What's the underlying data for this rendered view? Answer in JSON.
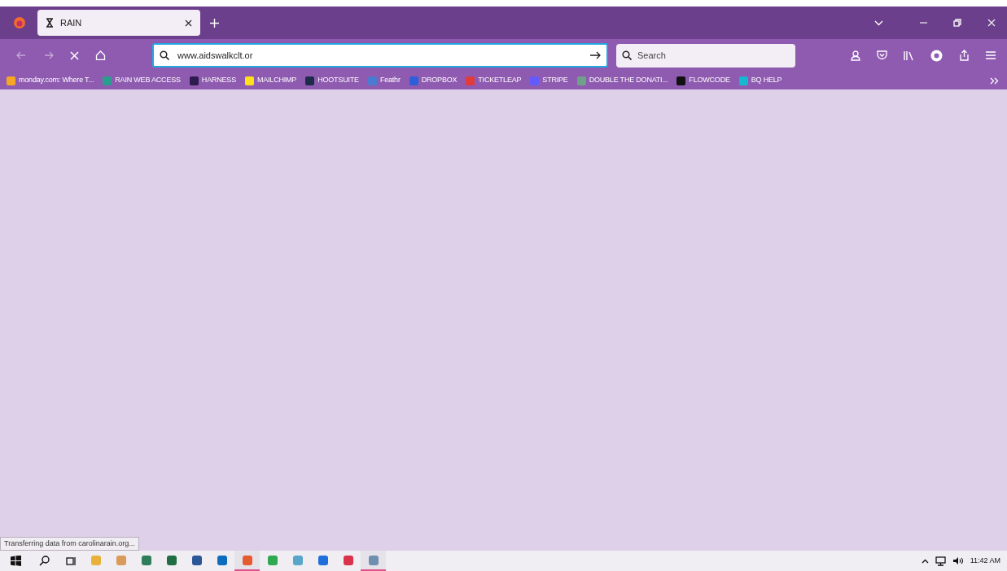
{
  "tab": {
    "title": "RAIN",
    "selected": true
  },
  "address_bar": {
    "value": "www.aidswalkclt.or"
  },
  "search": {
    "placeholder": "Search"
  },
  "bookmarks": [
    {
      "label": "monday.com: Where T...",
      "color": "#f5a623"
    },
    {
      "label": "RAIN WEB ACCESS",
      "color": "#2a9d8f"
    },
    {
      "label": "HARNESS",
      "color": "#2d1b4e"
    },
    {
      "label": "MAILCHIMP",
      "color": "#ffe01b"
    },
    {
      "label": "HOOTSUITE",
      "color": "#1c2b4a"
    },
    {
      "label": "Feathr",
      "color": "#4a7bd0"
    },
    {
      "label": "DROPBOX",
      "color": "#2f5fd8"
    },
    {
      "label": "TICKETLEAP",
      "color": "#e23b3b"
    },
    {
      "label": "STRIPE",
      "color": "#635bff"
    },
    {
      "label": "DOUBLE THE DONATI...",
      "color": "#6fa08a"
    },
    {
      "label": "FLOWCODE",
      "color": "#111111"
    },
    {
      "label": "BQ HELP",
      "color": "#16b8d0"
    }
  ],
  "status_text": "Transferring data from carolinarain.org...",
  "taskbar_apps": [
    {
      "color": "#e8b23a",
      "running": false
    },
    {
      "color": "#d99a5a",
      "running": false
    },
    {
      "color": "#2f7d5a",
      "running": false
    },
    {
      "color": "#1f6e43",
      "running": false
    },
    {
      "color": "#2b5797",
      "running": false
    },
    {
      "color": "#0f6cbd",
      "running": false
    },
    {
      "color": "#e55b2d",
      "running": true
    },
    {
      "color": "#2fa84f",
      "running": false
    },
    {
      "color": "#58a6c8",
      "running": false
    },
    {
      "color": "#1e6fd9",
      "running": false
    },
    {
      "color": "#d8334a",
      "running": false
    },
    {
      "color": "#6f8faf",
      "running": true
    }
  ],
  "clock": "11:42 AM"
}
